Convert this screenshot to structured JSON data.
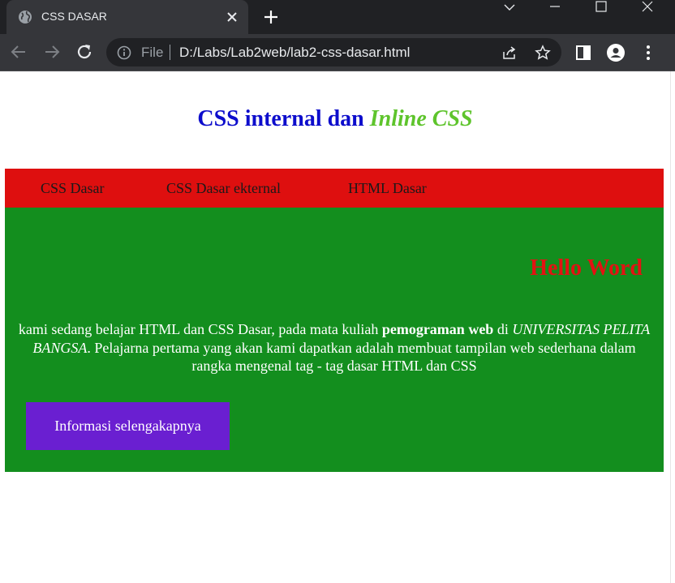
{
  "browser": {
    "tab_title": "CSS DASAR",
    "file_label": "File",
    "url": "D:/Labs/Lab2web/lab2-css-dasar.html"
  },
  "page": {
    "heading_main": "CSS internal dan ",
    "heading_inline": "Inline CSS",
    "nav": [
      {
        "label": "CSS Dasar"
      },
      {
        "label": "CSS Dasar ekternal"
      },
      {
        "label": "HTML Dasar"
      }
    ],
    "hello": "Hello Word",
    "paragraph": {
      "part1": "kami sedang belajar HTML dan CSS Dasar, pada mata kuliah ",
      "bold": "pemograman web",
      "part2": " di ",
      "italic": "UNIVERSITAS PELITA BANGSA",
      "part3": ". Pelajarna pertama yang akan kami dapatkan adalah membuat tampilan web sederhana dalam rangka mengenal tag - tag dasar HTML dan CSS"
    },
    "button_label": "Informasi selengakapnya"
  },
  "colors": {
    "heading_blue": "#0d0dcc",
    "heading_green": "#5ec42c",
    "navbar_red": "#de0f0f",
    "content_green": "#138e1e",
    "hello_red": "#e31212",
    "button_purple": "#6a1fd1"
  },
  "icons": [
    "globe-icon",
    "close-icon",
    "plus-icon",
    "chevron-down-icon",
    "minimize-icon",
    "maximize-icon",
    "window-close-icon",
    "back-arrow-icon",
    "forward-arrow-icon",
    "reload-icon",
    "info-icon",
    "share-icon",
    "star-icon",
    "side-panel-icon",
    "profile-icon",
    "menu-dots-icon"
  ]
}
